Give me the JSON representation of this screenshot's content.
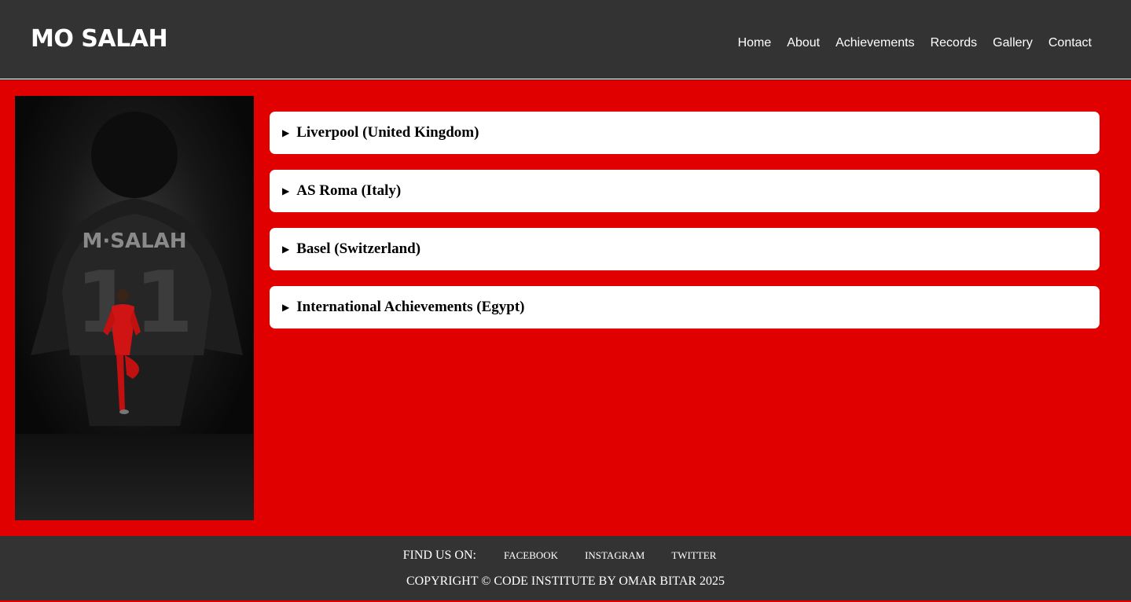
{
  "header": {
    "brand": "MO SALAH",
    "nav": [
      "Home",
      "About",
      "Achievements",
      "Records",
      "Gallery",
      "Contact"
    ]
  },
  "photo": {
    "jersey_name": "M·SALAH",
    "jersey_number": "11",
    "alt": "Mo Salah celebrating in red kit"
  },
  "accordion": {
    "items": [
      "Liverpool (United Kingdom)",
      "AS Roma (Italy)",
      "Basel (Switzerland)",
      "International Achievements (Egypt)"
    ],
    "arrow_icon": "▶"
  },
  "footer": {
    "find_us_label": "FIND US ON:",
    "social": [
      "FACEBOOK",
      "INSTAGRAM",
      "TWITTER"
    ],
    "copyright": "COPYRIGHT © CODE INSTITUTE BY OMAR BITAR 2025"
  },
  "colors": {
    "header_bg": "#333333",
    "main_bg": "#e00000",
    "accent": "#e00000"
  }
}
